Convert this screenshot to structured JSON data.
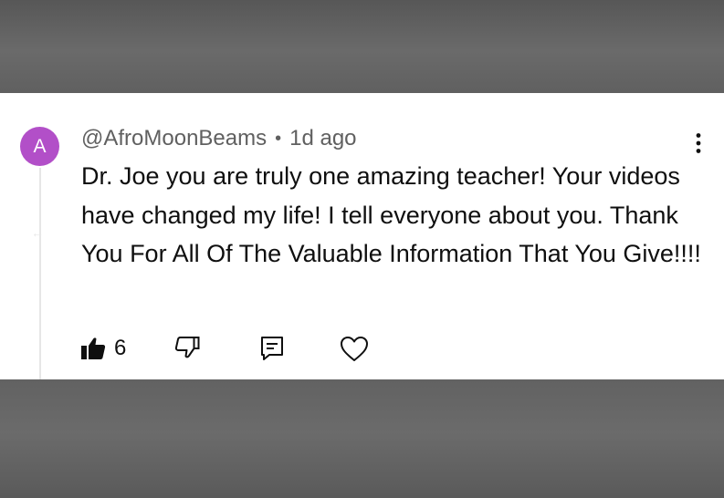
{
  "comment": {
    "avatar_letter": "A",
    "avatar_color": "#b24fc8",
    "author": "@AfroMoonBeams",
    "separator": "•",
    "time_ago": "1d ago",
    "text": "Dr. Joe you are truly one amazing teacher! Your videos have changed my life! I tell everyone about you. Thank You For All Of The Valuable Information That You Give!!!!",
    "like_count": "6",
    "liked": true,
    "icons": {
      "menu": "more-vertical-icon",
      "like": "thumbs-up-filled-icon",
      "dislike": "thumbs-down-icon",
      "reply": "reply-comment-icon",
      "heart": "heart-icon"
    }
  }
}
